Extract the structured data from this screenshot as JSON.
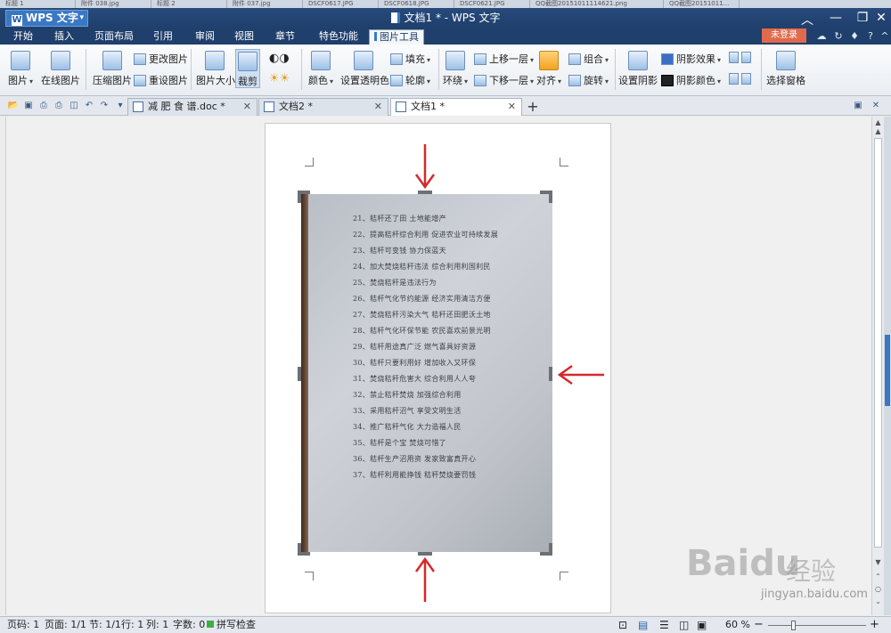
{
  "window": {
    "app_name": "WPS 文字",
    "title": "文档1 * - WPS 文字",
    "login_label": "未登录",
    "background_tabs": [
      "标题 1",
      "附件 038.jpg",
      "标题 2",
      "附件 037.jpg",
      "DSCF0617.JPG",
      "DSCF0618.JPG",
      "DSCF0621.JPG",
      "QQ截图20151011114621.png",
      "QQ截图20151011..."
    ]
  },
  "menu": {
    "tabs": [
      "开始",
      "插入",
      "页面布局",
      "引用",
      "审阅",
      "视图",
      "章节",
      "特色功能",
      "图片工具"
    ],
    "active_tab": "图片工具"
  },
  "ribbon": {
    "picture": "图片",
    "online_picture": "在线图片",
    "compress_picture": "压缩图片",
    "change_picture": "更改图片",
    "reset_picture": "重设图片",
    "picture_size": "图片大小",
    "crop": "裁剪",
    "color": "颜色",
    "set_transparent": "设置透明色",
    "fill": "填充",
    "outline": "轮廓",
    "wrap": "环绕",
    "bring_forward": "上移一层",
    "send_backward": "下移一层",
    "align": "对齐",
    "group": "组合",
    "rotate": "旋转",
    "set_shadow": "设置阴影",
    "shadow_effect": "阴影效果",
    "shadow_color": "阴影颜色",
    "selection_pane": "选择窗格"
  },
  "doc_tabs": [
    {
      "label": "减 肥 食 谱.doc *"
    },
    {
      "label": "文档2 *"
    },
    {
      "label": "文档1 *"
    }
  ],
  "document": {
    "photo_lines": [
      "21、秸秆还了田      土地能增产",
      "22、提高秸杆综合利用   促进农业可持续发展",
      "23、秸秆可变钱      协力保蓝天",
      "24、加大焚烧秸秆违法   综合利用利国利民",
      "25、焚烧秸秆是违法行为",
      "26、秸杆气化节约能源   经济实用清洁方便",
      "27、焚烧秸秆污染大气   秸秆还田肥沃土地",
      "28、秸秆气化环保节能   农民喜欢前景光明",
      "29、秸秆用途真广泛   燃气喜具好资源",
      "30、秸杆只要利用好   增加收入又环保",
      "31、焚烧秸秆危害大   综合利用人人夸",
      "32、禁止秸秆焚烧     加强综合利用",
      "33、采用秸杆沼气     享受文明生活",
      "34、推广秸秆气化     大力造福人民",
      "35、秸杆是个宝     焚烧可惜了",
      "36、秸杆生产沼用资   发家致富真开心",
      "37、秸杆利用能挣钱   秸秆焚烧要罚钱"
    ]
  },
  "status": {
    "page": "页码: 1",
    "pages": "页面: 1/1",
    "section": "节: 1/1",
    "row": "行: 1",
    "col": "列: 1",
    "words": "字数: 0",
    "spell": "拼写检查",
    "zoom": "60 %"
  },
  "watermark": {
    "brand": "Baidu",
    "jingyan": "经验",
    "url": "jingyan.baidu.com"
  },
  "colors": {
    "titlebar": "#1f3f6c",
    "accent": "#3a78c4",
    "login": "#e06a4c",
    "arrow": "#d42a2a"
  }
}
